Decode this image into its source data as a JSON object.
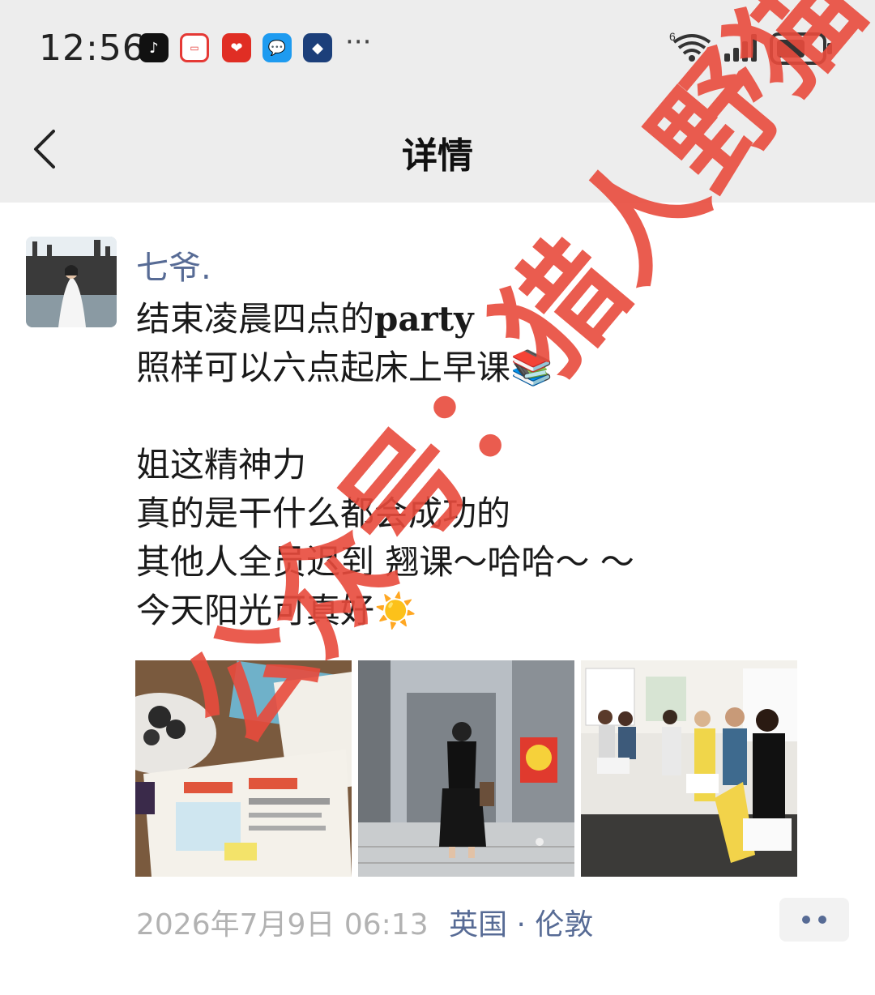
{
  "status_bar": {
    "time": "12:56",
    "app_icons": [
      "tiktok-icon",
      "live-app-icon",
      "pinduoduo-icon",
      "chat-bubble-icon",
      "game-app-icon"
    ],
    "network_label": "6"
  },
  "nav": {
    "title": "详情",
    "back_icon": "chevron-left-icon"
  },
  "post": {
    "username": "七爷.",
    "lines": [
      {
        "text": "结束凌晨四点的",
        "latin": "party"
      },
      {
        "text": "照样可以六点起床上早课📚"
      },
      {
        "text": "姐这精神力"
      },
      {
        "text": "真的是干什么都会成功的"
      },
      {
        "text": "其他人全员迟到 翘课～哈哈～ ～"
      },
      {
        "text": "今天阳光可真好☀️"
      }
    ],
    "photos": [
      "photo-textbook",
      "photo-elevator-selfie",
      "photo-classroom"
    ],
    "timestamp": "2026年7月9日 06:13",
    "location": "英国 · 伦敦"
  },
  "watermark": {
    "text": "公众号：猎人野猫",
    "color": "#e84a3c"
  },
  "colors": {
    "link": "#576b95",
    "bar_bg": "#ededed",
    "meta_gray": "#b2b2b2"
  }
}
